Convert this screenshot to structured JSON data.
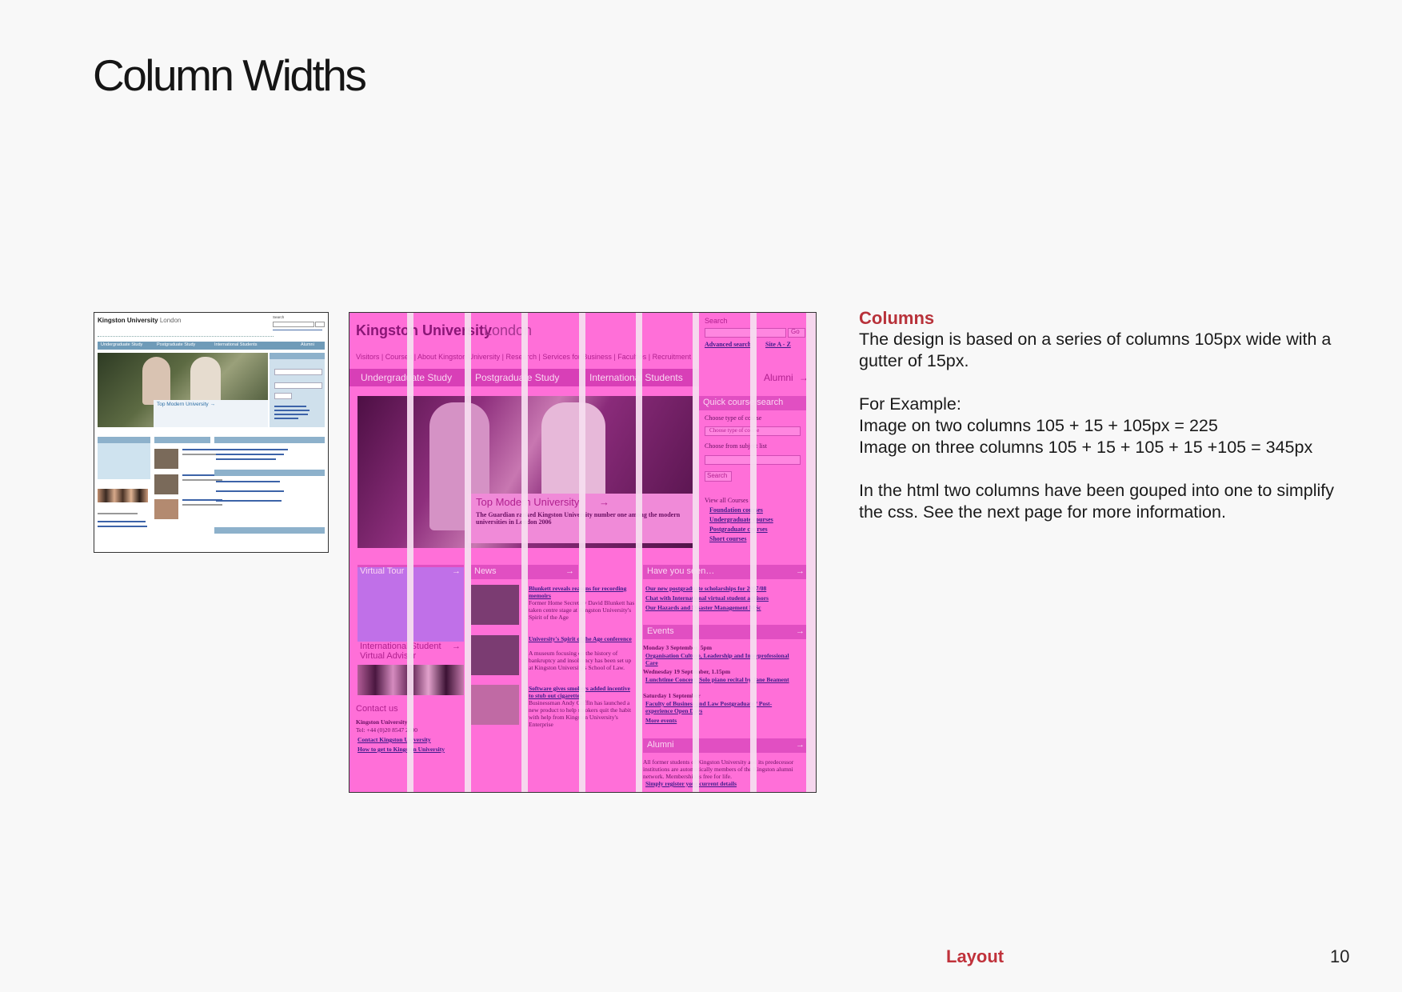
{
  "page": {
    "title": "Column Widths",
    "footer_label": "Layout",
    "page_number": "10"
  },
  "text": {
    "heading": "Columns",
    "para1": "The design is based on a series of columns 105px wide with a gutter of 15px.",
    "example_label": "For Example:",
    "example1": "Image on two columns 105 + 15 + 105px = 225",
    "example2": "Image on three columns 105 + 15 + 105 + 15 +105 = 345px",
    "para2": "In the html two columns have been gouped into one to simplify the css. See the next page for more information."
  },
  "thumb": {
    "logo_bold": "Kingston University",
    "logo_light": "London",
    "search": "Search",
    "tabs": [
      "Undergraduate Study",
      "Postgraduate Study",
      "International Students",
      "Alumni"
    ],
    "hero_caption": "Top Modern University →"
  },
  "overlay": {
    "logo_bold": "Kingston University",
    "logo_light": "London",
    "search_label": "Search",
    "go": "Go",
    "advanced_search": "Advanced search",
    "site_az": "Site A - Z",
    "nav": [
      "Visitors",
      "Courses",
      "About Kingston University",
      "Research",
      "Services for Business",
      "Faculties",
      "Recruitment"
    ],
    "tabs": [
      "Undergraduate Study",
      "Postgraduate Study",
      "International Students"
    ],
    "alumni_tab": "Alumni",
    "quick_search": "Quick course search",
    "choose_type": "Choose type of course",
    "choose_type_select": "Choose type of course",
    "choose_subject": "Choose from subject list",
    "search_button": "Search",
    "view_all": "View all Courses",
    "course_links": [
      "Foundation courses",
      "Undergraduate courses",
      "Postgraduate courses",
      "Short courses"
    ],
    "hero_title": "Top Modern University",
    "hero_text": "The Guardian ranked Kingston University number one among the modern universities in London 2006",
    "virtual_tour": "Virtual Tour",
    "news": "News",
    "have_you_seen": "Have you seen…",
    "news_items": [
      {
        "title": "Blunkett reveals reasons for recording memoirs",
        "body": "Former Home Secretary David Blunkett has taken centre stage at Kingston University's Spirit of the Age"
      },
      {
        "title": "University's Spirit of the Age conference",
        "body": "A museum focusing on the history of bankruptcy and insolvency has been set up at Kingston University's School of Law."
      },
      {
        "title": "Software gives smokers added incentive to stub out cigarettes",
        "body": "Businessman Andy Griffin has launched a new product to help smokers quit the habit with help from Kingston University's Enterprise"
      }
    ],
    "seen_links": [
      "Our new postgraduate scholarships for 2007/08",
      "Chat with International virtual student advisors",
      "Our Hazards and Disaster Management MSc"
    ],
    "isva": "International Student Virtual Advisor",
    "events": "Events",
    "events_items": [
      {
        "date": "Monday 3 September, 5pm",
        "link": "Organisation Culture, Leadership and Interprofessional Care"
      },
      {
        "date": "Wednesday 19 September, 1.15pm",
        "link": "Lunchtime Concert: Solo piano recital by Jane Beament"
      },
      {
        "date": "Saturday 1 September",
        "link": "Faculty of Business and Law Postgraduate / Post-experience Open Days"
      }
    ],
    "more_events": "More events",
    "contact": "Contact us",
    "contact_name": "Kingston University",
    "contact_tel": "Tel: +44 (0)20 8547 2000",
    "contact_links": [
      "Contact Kingston University",
      "How to get to Kingston University"
    ],
    "alumni": "Alumni",
    "alumni_text": "All former students of Kingston University and its predecessor institutions are automatically members of the Kingston alumni network. Membership is free for life.",
    "alumni_link": "Simply register your current details"
  }
}
